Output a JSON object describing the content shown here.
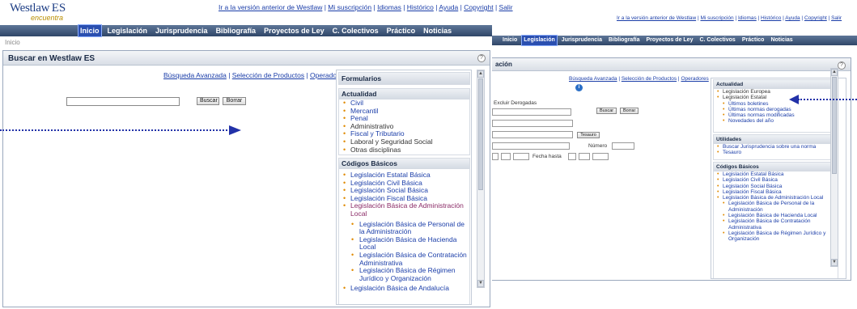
{
  "main_window": {
    "logo": {
      "westlaw": "Westlaw",
      "es": "ES",
      "tagline": "encuentra"
    },
    "top_links": [
      "Ir a la versión anterior de Westlaw",
      "Mi suscripción",
      "Idiomas",
      "Histórico",
      "Ayuda",
      "Copyright",
      "Salir"
    ],
    "nav": [
      "Inicio",
      "Legislación",
      "Jurisprudencia",
      "Bibliografía",
      "Proyectos de Ley",
      "C. Colectivos",
      "Práctico",
      "Noticias"
    ],
    "nav_active": "Inicio",
    "breadcrumb": "Inicio",
    "panel_title": "Buscar en Westlaw ES",
    "help": "?",
    "search_links": [
      "Búsqueda Avanzada",
      "Selección de Productos",
      "Operadores"
    ],
    "search_value": "",
    "buttons": {
      "search": "Buscar",
      "clear": "Borrar"
    },
    "sidebar": {
      "formularios": "Formularios",
      "actualidad": {
        "title": "Actualidad",
        "items": [
          "Civil",
          "Mercantil",
          "Penal",
          "Administrativo",
          "Fiscal y Tributario",
          "Laboral y Seguridad Social",
          "Otras disciplinas"
        ]
      },
      "codigos": {
        "title": "Códigos Básicos",
        "items": [
          "Legislación Estatal Básica",
          "Legislación Civil Básica",
          "Legislación Social Básica",
          "Legislación Fiscal Básica",
          "Legislación Básica de Administración Local"
        ],
        "subitems": [
          "Legislación Básica de Personal de la Administración",
          "Legislación Básica de Hacienda Local",
          "Legislación Básica de Contratación Administrativa",
          "Legislación Básica de Régimen Jurídico y Organización"
        ],
        "last": "Legislación Básica de Andalucía"
      }
    }
  },
  "secondary_window": {
    "top_links": [
      "Ir a la versión anterior de Westlaw",
      "Mi suscripción",
      "Idiomas",
      "Histórico",
      "Ayuda",
      "Copyright",
      "Salir"
    ],
    "nav": [
      "Inicio",
      "Legislación",
      "Jurisprudencia",
      "Bibliografía",
      "Proyectos de Ley",
      "C. Colectivos",
      "Práctico",
      "Noticias"
    ],
    "nav_active": "Legislación",
    "panel_title": "ación",
    "help": "?",
    "search_links": [
      "Búsqueda Avanzada",
      "Selección de Productos",
      "Operadores"
    ],
    "exclude_label": "Excluir Derogadas",
    "buttons": {
      "search": "Buscar",
      "clear": "Borrar",
      "thesaurus": "Tesauro"
    },
    "number_label": "Número",
    "date_to_label": "Fecha hasta",
    "sidebar": {
      "actualidad": {
        "title": "Actualidad",
        "items": [
          "Legislación Europea",
          "Legislación Estatal"
        ],
        "subitems": [
          "Últimos boletines",
          "Últimas normas derogadas",
          "Últimas normas modificadas",
          "Novedades del año"
        ]
      },
      "utilidades": {
        "title": "Utilidades",
        "items": [
          "Buscar Jurisprudencia sobre una norma",
          "Tesauro"
        ]
      },
      "codigos": {
        "title": "Códigos Básicos",
        "items": [
          "Legislación Estatal Básica",
          "Legislación Civil Básica",
          "Legislación Social Básica",
          "Legislación Fiscal Básica",
          "Legislación Básica de Administración Local"
        ],
        "subitems": [
          "Legislación Básica de Personal de la Administración",
          "Legislación Básica de Hacienda Local",
          "Legislación Básica de Contratación Administrativa",
          "Legislación Básica de Régimen Jurídico y Organización"
        ]
      }
    }
  },
  "colors": {
    "nav": "#3c5478",
    "link": "#1a3da8",
    "bullet": "#e08a00",
    "arrow": "#2231a8"
  }
}
